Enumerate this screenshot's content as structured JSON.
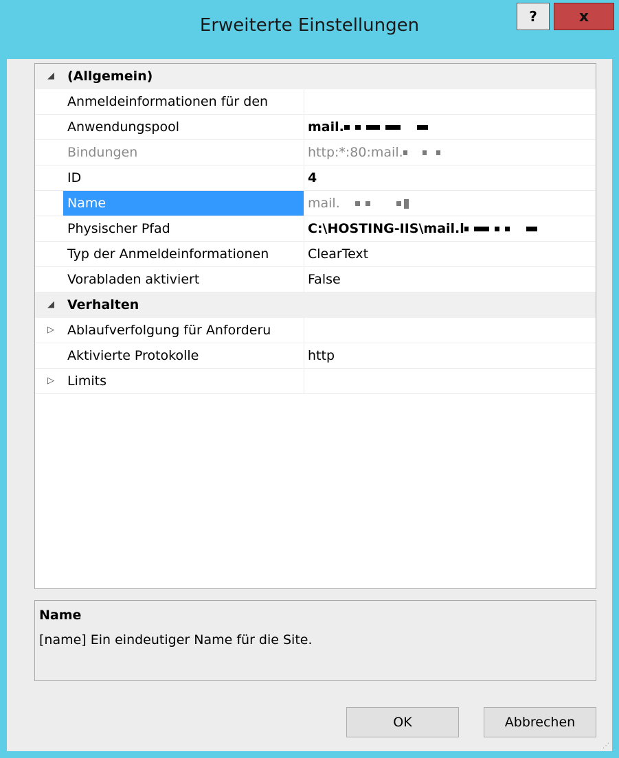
{
  "window": {
    "title": "Erweiterte Einstellungen",
    "help_label": "?",
    "close_label": "x"
  },
  "grid": {
    "categories": [
      {
        "label": "(Allgemein)",
        "glyph": "◢"
      },
      {
        "label": "Verhalten",
        "glyph": "◢"
      }
    ],
    "general_rows": [
      {
        "name": "Anmeldeinformationen für den",
        "value": ""
      },
      {
        "name": "Anwendungspool",
        "value": "mail."
      },
      {
        "name": "Bindungen",
        "value": "http:*:80:mail."
      },
      {
        "name": "ID",
        "value": "4"
      },
      {
        "name": "Name",
        "value": "mail."
      },
      {
        "name": "Physischer Pfad",
        "value": "C:\\HOSTING-IIS\\mail.l"
      },
      {
        "name": "Typ der Anmeldeinformationen",
        "value": "ClearText"
      },
      {
        "name": "Vorabladen aktiviert",
        "value": "False"
      }
    ],
    "behavior_rows": [
      {
        "name": "Ablaufverfolgung für Anforderu",
        "value": "",
        "glyph": "▷"
      },
      {
        "name": "Aktivierte Protokolle",
        "value": "http"
      },
      {
        "name": "Limits",
        "value": "",
        "glyph": "▷"
      }
    ]
  },
  "description": {
    "title": "Name",
    "text": "[name] Ein eindeutiger Name für die Site."
  },
  "buttons": {
    "ok": "OK",
    "cancel": "Abbrechen"
  },
  "colors": {
    "titlebar": "#5ecde6",
    "close_button": "#c34545",
    "selection": "#3399ff"
  }
}
